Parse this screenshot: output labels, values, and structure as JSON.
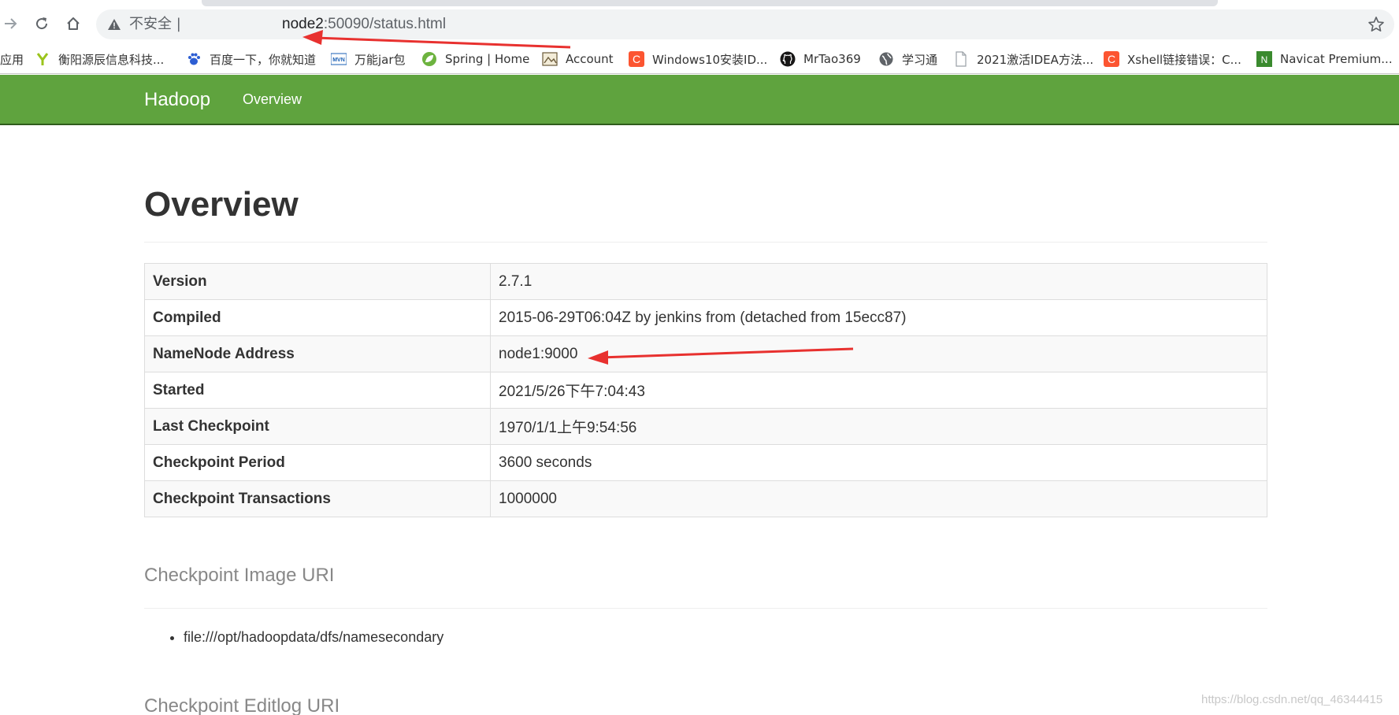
{
  "browser": {
    "security_label": "不安全 |",
    "url_host": "node2",
    "url_path": ":50090/status.html",
    "colors": {
      "omnibox_bg": "#f1f3f4",
      "warning": "#5f6368"
    }
  },
  "bookmarks": [
    {
      "label": "应用",
      "icon": "apps-icon"
    },
    {
      "label": "衡阳源辰信息科技...",
      "icon": "y-logo-icon"
    },
    {
      "label": "百度一下，你就知道",
      "icon": "baidu-paw-icon"
    },
    {
      "label": "万能jar包",
      "icon": "mvn-icon"
    },
    {
      "label": "Spring | Home",
      "icon": "spring-leaf-icon"
    },
    {
      "label": "Account",
      "icon": "account-image-icon"
    },
    {
      "label": "Windows10安装ID...",
      "icon": "csdn-c-icon"
    },
    {
      "label": "MrTao369",
      "icon": "github-icon"
    },
    {
      "label": "学习通",
      "icon": "globe-icon"
    },
    {
      "label": "2021激活IDEA方法...",
      "icon": "page-icon"
    },
    {
      "label": "Xshell链接错误：C...",
      "icon": "csdn-c-icon"
    },
    {
      "label": "Navicat Premium...",
      "icon": "navicat-icon"
    }
  ],
  "navbar": {
    "brand": "Hadoop",
    "link": "Overview",
    "color": "#5fa33e"
  },
  "main": {
    "title": "Overview",
    "rows": [
      {
        "label": "Version",
        "value": "2.7.1"
      },
      {
        "label": "Compiled",
        "value": "2015-06-29T06:04Z by jenkins from (detached from 15ecc87)"
      },
      {
        "label": "NameNode Address",
        "value": "node1:9000"
      },
      {
        "label": "Started",
        "value": "2021/5/26下午7:04:43"
      },
      {
        "label": "Last Checkpoint",
        "value": "1970/1/1上午9:54:56"
      },
      {
        "label": "Checkpoint Period",
        "value": "3600 seconds"
      },
      {
        "label": "Checkpoint Transactions",
        "value": "1000000"
      }
    ],
    "image_uri_heading": "Checkpoint Image URI",
    "image_uris": [
      "file:///opt/hadoopdata/dfs/namesecondary"
    ],
    "editlog_uri_heading": "Checkpoint Editlog URI"
  },
  "watermark": "https://blog.csdn.net/qq_46344415",
  "annotation_color": "#e8312f"
}
